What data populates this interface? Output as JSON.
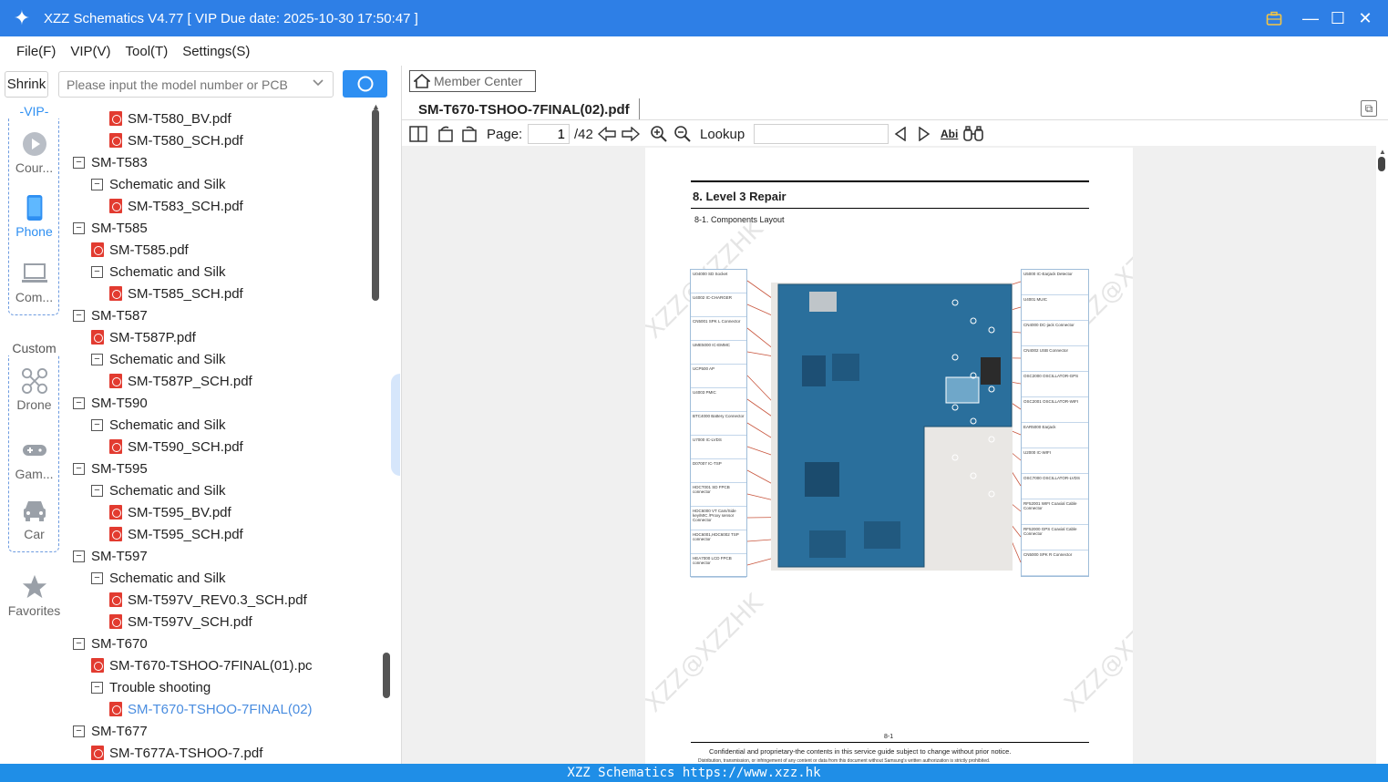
{
  "window": {
    "title": "XZZ Schematics V4.77 [ VIP Due date: 2025-10-30 17:50:47 ]",
    "logo_glyph": "✦",
    "controls": {
      "minimize": "—",
      "maximize": "☐",
      "close": "✕"
    }
  },
  "menu": [
    "File(F)",
    "VIP(V)",
    "Tool(T)",
    "Settings(S)"
  ],
  "search": {
    "shrink_label": "Shrink",
    "placeholder": "Please input the model number or PCB"
  },
  "sidebar": {
    "vip_group_label": "-VIP-",
    "vip_items": [
      "Cour...",
      "Phone",
      "Com..."
    ],
    "custom_group_label": "Custom",
    "custom_items": [
      "Drone",
      "Gam...",
      "Car"
    ],
    "favorites_label": "Favorites",
    "accent_color": "#2e8ff2"
  },
  "tree": [
    {
      "type": "file",
      "label": "SM-T580_BV.pdf",
      "level": 2
    },
    {
      "type": "file",
      "label": "SM-T580_SCH.pdf",
      "level": 2
    },
    {
      "type": "folder",
      "label": "SM-T583",
      "level": 0
    },
    {
      "type": "folder",
      "label": "Schematic and Silk",
      "level": 1
    },
    {
      "type": "file",
      "label": "SM-T583_SCH.pdf",
      "level": 2
    },
    {
      "type": "folder",
      "label": "SM-T585",
      "level": 0
    },
    {
      "type": "file",
      "label": "SM-T585.pdf",
      "level": 1
    },
    {
      "type": "folder",
      "label": "Schematic and Silk",
      "level": 1
    },
    {
      "type": "file",
      "label": "SM-T585_SCH.pdf",
      "level": 2
    },
    {
      "type": "folder",
      "label": "SM-T587",
      "level": 0
    },
    {
      "type": "file",
      "label": "SM-T587P.pdf",
      "level": 1
    },
    {
      "type": "folder",
      "label": "Schematic and Silk",
      "level": 1
    },
    {
      "type": "file",
      "label": "SM-T587P_SCH.pdf",
      "level": 2
    },
    {
      "type": "folder",
      "label": "SM-T590",
      "level": 0
    },
    {
      "type": "folder",
      "label": "Schematic and Silk",
      "level": 1
    },
    {
      "type": "file",
      "label": "SM-T590_SCH.pdf",
      "level": 2
    },
    {
      "type": "folder",
      "label": "SM-T595",
      "level": 0
    },
    {
      "type": "folder",
      "label": "Schematic and Silk",
      "level": 1
    },
    {
      "type": "file",
      "label": "SM-T595_BV.pdf",
      "level": 2
    },
    {
      "type": "file",
      "label": "SM-T595_SCH.pdf",
      "level": 2
    },
    {
      "type": "folder",
      "label": "SM-T597",
      "level": 0
    },
    {
      "type": "folder",
      "label": "Schematic and Silk",
      "level": 1
    },
    {
      "type": "file",
      "label": "SM-T597V_REV0.3_SCH.pdf",
      "level": 2
    },
    {
      "type": "file",
      "label": "SM-T597V_SCH.pdf",
      "level": 2
    },
    {
      "type": "folder",
      "label": "SM-T670",
      "level": 0
    },
    {
      "type": "file",
      "label": "SM-T670-TSHOO-7FINAL(01).pc",
      "level": 1
    },
    {
      "type": "folder",
      "label": "Trouble shooting",
      "level": 1
    },
    {
      "type": "file",
      "label": "SM-T670-TSHOO-7FINAL(02)",
      "level": 2,
      "selected": true
    },
    {
      "type": "folder",
      "label": "SM-T677",
      "level": 0
    },
    {
      "type": "file",
      "label": "SM-T677A-TSHOO-7.pdf",
      "level": 1
    }
  ],
  "viewer": {
    "member_center": "Member Center",
    "tab_title": "SM-T670-TSHOO-7FINAL(02).pdf",
    "page_label": "Page:",
    "page_current": "1",
    "page_total": "/42",
    "lookup_label": "Lookup",
    "abi_label": "Abi"
  },
  "document": {
    "heading": "8.  Level  3  Repair",
    "subheading": "8-1.  Components  Layout",
    "watermark": "XZZ@XZZHK",
    "left_labels": [
      "U04000 SD Socket",
      "U4002 IC-CHARGER",
      "CN5001 SPK L Connector",
      "UME5000 IC-EMMC",
      "UCP500 AP",
      "U4003 PMIC",
      "BTC4000 Battery Connector",
      "U7000 IC-LVDS",
      "D07007 IC-TSP",
      "HDCT001 SD FPCB connector",
      "HDC6000 VT Cam/Side key/MIC /Proxy sensor Connector",
      "HDC6001,HDC6002 TSP connector",
      "HEA7000 LCD FPCB connector"
    ],
    "right_labels": [
      "U5000 IC-Earjack Detector",
      "U4001 MUIC",
      "CN4000 DC-jack Connector",
      "CN4002 USB Connector",
      "OSC2000 OSCILLATOR-GPS",
      "OSC2001 OSCILLATOR-WIFI",
      "EAR5000 Earjack",
      "U2000 IC-WIFI",
      "OSC7000 OSCILLATOR-LVDS",
      "RF52001 WIFI Coaxial Cable Connector",
      "RF52000 GPS Coaxial Cable Connector",
      "CN5000 SPK R Connector"
    ],
    "page_number": "8-1",
    "footer_line1": "Confidential  and  proprietary-the  contents  in  this  service  guide  subject  to  change  without  prior  notice.",
    "footer_line2": "Distribution, transmission, or infringement of any content or data from this document without Samsung's written authorization is strictly prohibited.",
    "board_color": "#2a6f9c"
  },
  "statusbar": {
    "text": "XZZ Schematics https://www.xzz.hk"
  }
}
